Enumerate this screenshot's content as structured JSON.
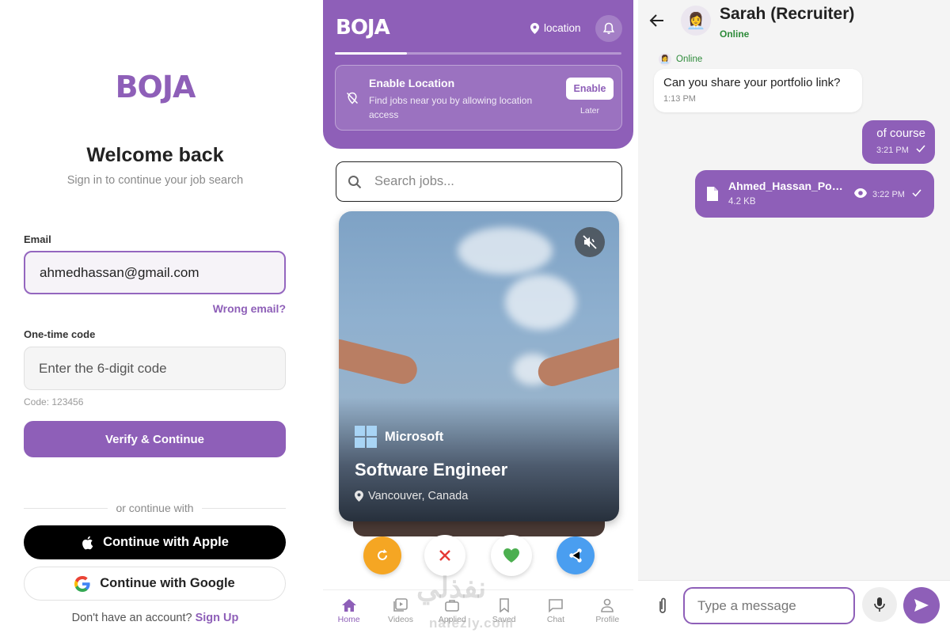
{
  "colors": {
    "brand": "#8e5fb8",
    "online": "#2e8b3a",
    "undo": "#f5a623",
    "share": "#4a9ef0",
    "like": "#4caf50",
    "nope": "#e53935"
  },
  "login": {
    "logo": "BOJA",
    "title": "Welcome back",
    "subtitle": "Sign in to continue your job search",
    "email_label": "Email",
    "email_value": "ahmedhassan@gmail.com",
    "wrong_email": "Wrong email?",
    "code_label": "One-time code",
    "code_placeholder": "Enter the 6-digit code",
    "code_hint": "Code: 123456",
    "verify_button": "Verify & Continue",
    "divider_text": "or continue with",
    "apple_button": "Continue with Apple",
    "google_button": "Continue with Google",
    "no_account_text": "Don't have an account?",
    "signup_link": "Sign Up"
  },
  "feed": {
    "logo": "BOJA",
    "location_label": "location",
    "location_progress": 0.25,
    "enable_location": {
      "title": "Enable Location",
      "description": "Find jobs near you by allowing location access",
      "enable_button": "Enable",
      "later_button": "Later"
    },
    "search_placeholder": "Search jobs...",
    "job": {
      "company": "Microsoft",
      "title": "Software Engineer",
      "location": "Vancouver, Canada"
    },
    "nav": [
      {
        "label": "Home",
        "icon": "home-icon"
      },
      {
        "label": "Videos",
        "icon": "videos-icon"
      },
      {
        "label": "Applied",
        "icon": "applied-icon"
      },
      {
        "label": "Saved",
        "icon": "bookmark-icon"
      },
      {
        "label": "Chat",
        "icon": "chat-icon"
      },
      {
        "label": "Profile",
        "icon": "profile-icon"
      }
    ],
    "watermark_arabic": "نفذلي",
    "watermark_latin": "nafezly.com"
  },
  "chat": {
    "contact_name": "Sarah (Recruiter)",
    "contact_status": "Online",
    "mini_status": "Online",
    "messages": [
      {
        "text": "Can you share your portfolio link?",
        "time": "1:13 PM"
      },
      {
        "text": "of course",
        "time": "3:21 PM"
      },
      {
        "file_name": "Ahmed_Hassan_Portfolio.pdf",
        "file_size": "4.2 KB",
        "time": "3:22 PM"
      }
    ],
    "input_placeholder": "Type a message"
  }
}
